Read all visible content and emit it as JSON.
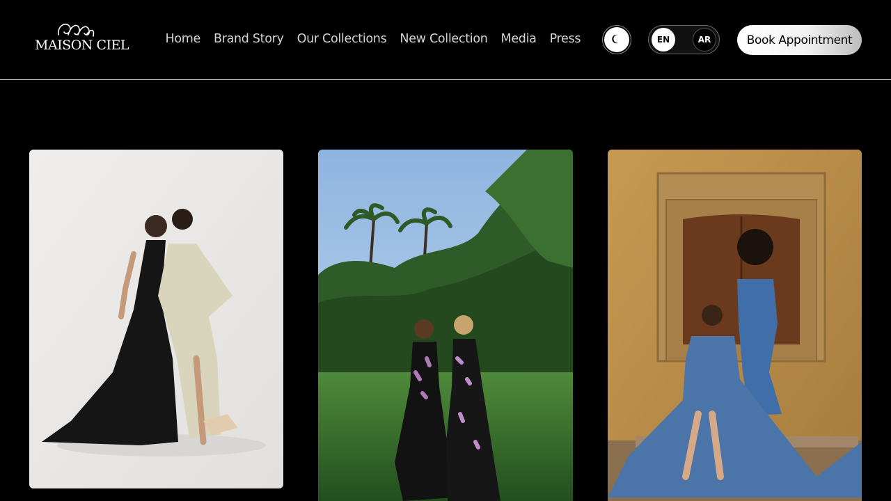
{
  "brand": {
    "name": "MAISON CIEL",
    "logo_icon": "swirl-monogram"
  },
  "nav": {
    "items": [
      {
        "label": "Home"
      },
      {
        "label": "Brand Story"
      },
      {
        "label": "Our Collections"
      },
      {
        "label": "New Collection"
      },
      {
        "label": "Media"
      },
      {
        "label": "Press"
      }
    ]
  },
  "controls": {
    "theme_icon": "moon-icon",
    "lang_en": "EN",
    "lang_ar": "AR",
    "cta_label": "Book Appointment"
  },
  "gallery": {
    "photos": [
      {
        "scene": "studio-white",
        "icon": "photo"
      },
      {
        "scene": "garden-palms",
        "icon": "photo"
      },
      {
        "scene": "stone-doorway",
        "icon": "photo"
      }
    ]
  },
  "colors": {
    "background": "#000000",
    "nav_text": "#d4d4d4",
    "cta_bg": "#ffffff",
    "divider": "#cfcfcf"
  }
}
